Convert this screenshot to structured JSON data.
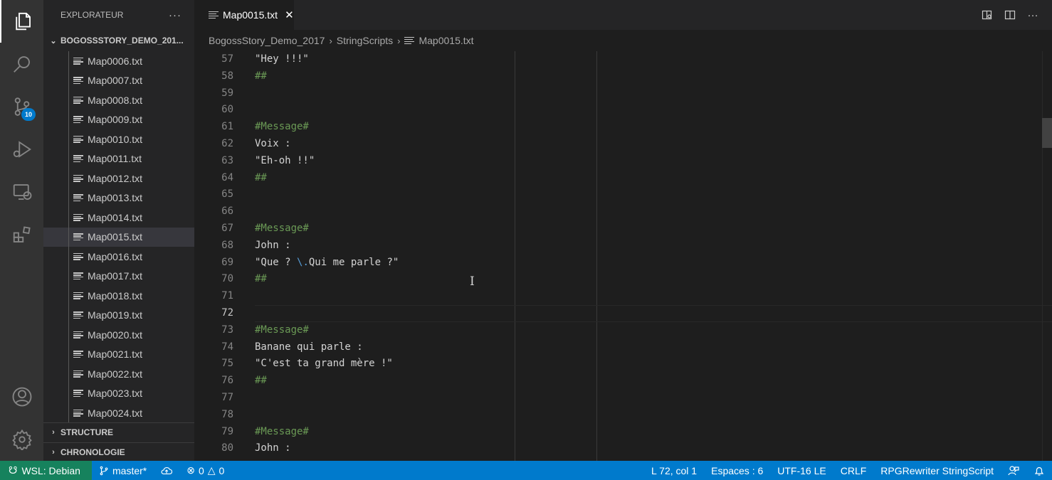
{
  "activity_bar": {
    "scm_badge": "10"
  },
  "sidebar": {
    "title": "EXPLORATEUR",
    "more": "···",
    "root_folder": "BOGOSSSTORY_DEMO_201...",
    "files": [
      "Map0006.txt",
      "Map0007.txt",
      "Map0008.txt",
      "Map0009.txt",
      "Map0010.txt",
      "Map0011.txt",
      "Map0012.txt",
      "Map0013.txt",
      "Map0014.txt",
      "Map0015.txt",
      "Map0016.txt",
      "Map0017.txt",
      "Map0018.txt",
      "Map0019.txt",
      "Map0020.txt",
      "Map0021.txt",
      "Map0022.txt",
      "Map0023.txt",
      "Map0024.txt"
    ],
    "selected_file": "Map0015.txt",
    "sections": [
      "STRUCTURE",
      "CHRONOLOGIE"
    ]
  },
  "tab": {
    "label": "Map0015.txt",
    "close": "✕"
  },
  "breadcrumb": {
    "parts": [
      "BogossStory_Demo_2017",
      "StringScripts",
      "Map0015.txt"
    ]
  },
  "editor": {
    "current_line": 72,
    "lines": [
      {
        "n": "57",
        "text": "\"Hey !!!\"",
        "kind": "text"
      },
      {
        "n": "58",
        "text": "##",
        "kind": "comment"
      },
      {
        "n": "59",
        "text": "",
        "kind": "text"
      },
      {
        "n": "60",
        "text": "",
        "kind": "text"
      },
      {
        "n": "61",
        "text": "#Message#",
        "kind": "comment"
      },
      {
        "n": "62",
        "text": "Voix :",
        "kind": "text"
      },
      {
        "n": "63",
        "text": "\"Eh-oh !!\"",
        "kind": "text"
      },
      {
        "n": "64",
        "text": "##",
        "kind": "comment"
      },
      {
        "n": "65",
        "text": "",
        "kind": "text"
      },
      {
        "n": "66",
        "text": "",
        "kind": "text"
      },
      {
        "n": "67",
        "text": "#Message#",
        "kind": "comment"
      },
      {
        "n": "68",
        "text": "John :",
        "kind": "text"
      },
      {
        "n": "69",
        "pre": "\"Que ? ",
        "esc": "\\.",
        "post": "Qui me parle ?\"",
        "kind": "escape"
      },
      {
        "n": "70",
        "text": "##",
        "kind": "comment"
      },
      {
        "n": "71",
        "text": "",
        "kind": "text"
      },
      {
        "n": "72",
        "text": "",
        "kind": "text"
      },
      {
        "n": "73",
        "text": "#Message#",
        "kind": "comment"
      },
      {
        "n": "74",
        "text": "Banane qui parle :",
        "kind": "text"
      },
      {
        "n": "75",
        "text": "\"C'est ta grand mère !\"",
        "kind": "text"
      },
      {
        "n": "76",
        "text": "##",
        "kind": "comment"
      },
      {
        "n": "77",
        "text": "",
        "kind": "text"
      },
      {
        "n": "78",
        "text": "",
        "kind": "text"
      },
      {
        "n": "79",
        "text": "#Message#",
        "kind": "comment"
      },
      {
        "n": "80",
        "text": "John :",
        "kind": "text"
      }
    ]
  },
  "statusbar": {
    "remote": "WSL: Debian",
    "branch": "master*",
    "errors": "0",
    "warnings": "0",
    "position": "L 72, col 1",
    "indent": "Espaces : 6",
    "encoding": "UTF-16 LE",
    "eol": "CRLF",
    "language": "RPGRewriter StringScript"
  },
  "colors": {
    "statusbar": "#007acc",
    "remote": "#16825d",
    "comment": "#6a9955",
    "escape": "#569cd6"
  }
}
